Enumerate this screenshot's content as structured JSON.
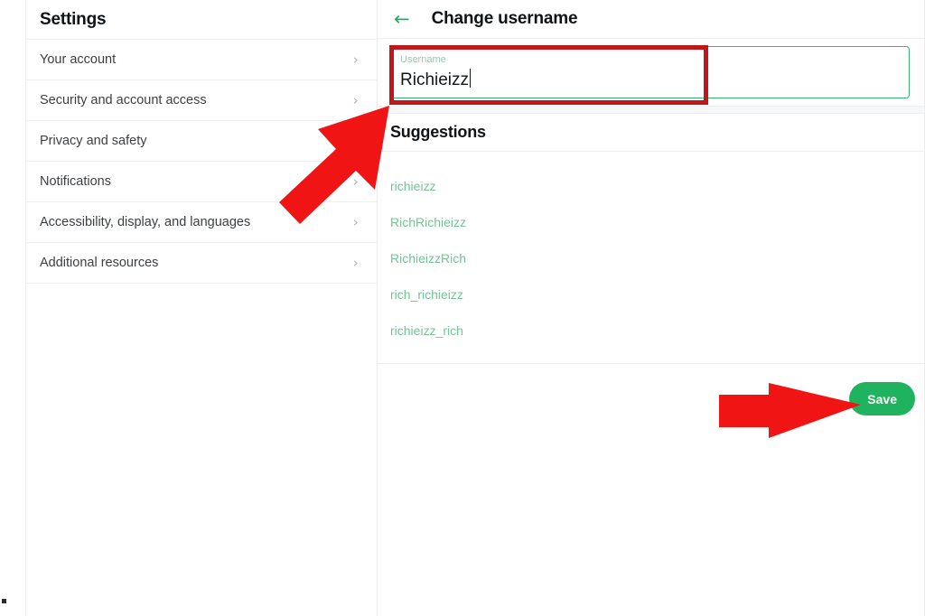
{
  "sidebar": {
    "title": "Settings",
    "items": [
      {
        "label": "Your account",
        "chevron": "›"
      },
      {
        "label": "Security and account access",
        "chevron": "›"
      },
      {
        "label": "Privacy and safety",
        "chevron": "›"
      },
      {
        "label": "Notifications",
        "chevron": "›"
      },
      {
        "label": "Accessibility, display, and languages",
        "chevron": "›"
      },
      {
        "label": "Additional resources",
        "chevron": "›"
      }
    ]
  },
  "main": {
    "back_icon": "←",
    "title": "Change username",
    "username_field": {
      "label": "Username",
      "value": "Richieizz",
      "placeholder": "Username"
    },
    "suggestions": {
      "title": "Suggestions",
      "items": [
        "richieizz",
        "RichRichieizz",
        "RichieizzRich",
        "rich_richieizz",
        "richieizz_rich"
      ]
    },
    "save_label": "Save"
  },
  "colors": {
    "accent_green": "#20b35f",
    "field_border_green": "#37b26d",
    "suggestion_green": "#74c495",
    "annotation_red": "#ee1c1c",
    "highlight_box_red": "#c0171b"
  }
}
